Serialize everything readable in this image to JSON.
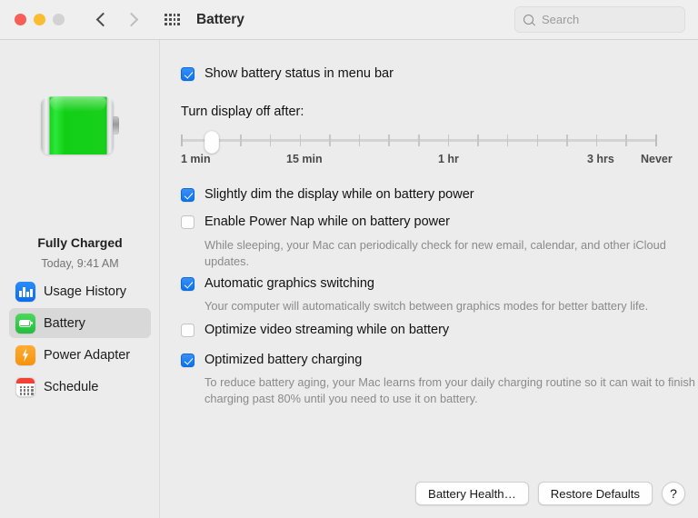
{
  "window": {
    "title": "Battery",
    "traffic_lights": [
      {
        "name": "close",
        "color": "#f65e57"
      },
      {
        "name": "minimize",
        "color": "#f9bd2f"
      },
      {
        "name": "zoom",
        "color": "#d2d2d2"
      }
    ],
    "nav": {
      "back": "‹",
      "forward": "›"
    },
    "grid_icon": "grid-dots-icon"
  },
  "search": {
    "placeholder": "Search",
    "value": ""
  },
  "sidebar": {
    "battery_icon": "battery-full-green",
    "status": "Fully Charged",
    "status_time": "Today, 9:41 AM",
    "items": [
      {
        "label": "Usage History",
        "icon": "bar-chart-icon",
        "selected": false
      },
      {
        "label": "Battery",
        "icon": "battery-icon",
        "selected": true
      },
      {
        "label": "Power Adapter",
        "icon": "lightning-bolt-icon",
        "selected": false
      },
      {
        "label": "Schedule",
        "icon": "calendar-icon",
        "selected": false
      }
    ]
  },
  "main": {
    "show_menu_bar": {
      "label": "Show battery status in menu bar",
      "checked": true
    },
    "display_off": {
      "label": "Turn display off after:",
      "ticks": 17,
      "thumb_index": 1,
      "tick_labels": [
        {
          "text": "1 min",
          "pos_pct": 0
        },
        {
          "text": "15 min",
          "pos_pct": 25
        },
        {
          "text": "1 hr",
          "pos_pct": 56.5
        },
        {
          "text": "3 hrs",
          "pos_pct": 88
        },
        {
          "text": "Never",
          "pos_pct": 99.5
        }
      ]
    },
    "options": [
      {
        "label": "Slightly dim the display while on battery power",
        "checked": true,
        "description": ""
      },
      {
        "label": "Enable Power Nap while on battery power",
        "checked": false,
        "description": "While sleeping, your Mac can periodically check for new email, calendar, and other iCloud updates."
      },
      {
        "label": "Automatic graphics switching",
        "checked": true,
        "description": "Your computer will automatically switch between graphics modes for better battery life."
      },
      {
        "label": "Optimize video streaming while on battery",
        "checked": false,
        "description": ""
      },
      {
        "label": "Optimized battery charging",
        "checked": true,
        "description": "To reduce battery aging, your Mac learns from your daily charging routine so it can wait to finish charging past 80% until you need to use it on battery."
      }
    ],
    "buttons": {
      "battery_health": "Battery Health…",
      "restore_defaults": "Restore Defaults",
      "help": "?"
    }
  },
  "colors": {
    "accent": "#0a74ef",
    "battery_green": "#2ce83a",
    "window_bg": "#ececec",
    "toolbar_bg": "#f0efef"
  }
}
